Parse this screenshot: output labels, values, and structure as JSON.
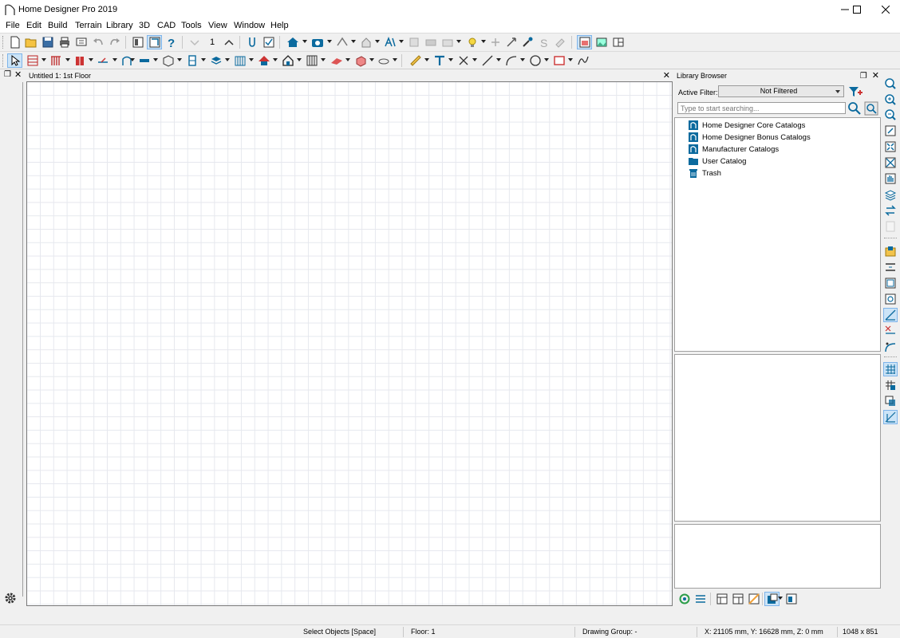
{
  "window": {
    "title": "Home Designer Pro 2019",
    "controls": [
      "minimize",
      "maximize",
      "close"
    ]
  },
  "menu": [
    "File",
    "Edit",
    "Build",
    "Terrain",
    "Library",
    "3D",
    "CAD",
    "Tools",
    "View",
    "Window",
    "Help"
  ],
  "toolbar": {
    "floor_number": "1"
  },
  "document": {
    "tab_title": "Untitled 1: 1st Floor",
    "close_label": "✕"
  },
  "library": {
    "title": "Library Browser",
    "filter_label": "Active Filter:",
    "filter_value": "Not Filtered",
    "search_placeholder": "Type to start searching...",
    "items": [
      {
        "label": "Home Designer Core Catalogs",
        "icon": "catalog-icon"
      },
      {
        "label": "Home Designer Bonus Catalogs",
        "icon": "catalog-icon"
      },
      {
        "label": "Manufacturer Catalogs",
        "icon": "catalog-icon"
      },
      {
        "label": "User Catalog",
        "icon": "folder-icon"
      },
      {
        "label": "Trash",
        "icon": "trash-icon"
      }
    ]
  },
  "status": {
    "mode": "Select Objects [Space]",
    "floor": "Floor: 1",
    "drawing_group": "Drawing Group: -",
    "coords": "X: 21105 mm, Y: 16628 mm, Z: 0 mm",
    "size": "1048 x 851"
  },
  "colors": {
    "accent": "#0b6a9e",
    "active_button": "#cce4f7",
    "grid_line": "#e6e8ee"
  }
}
